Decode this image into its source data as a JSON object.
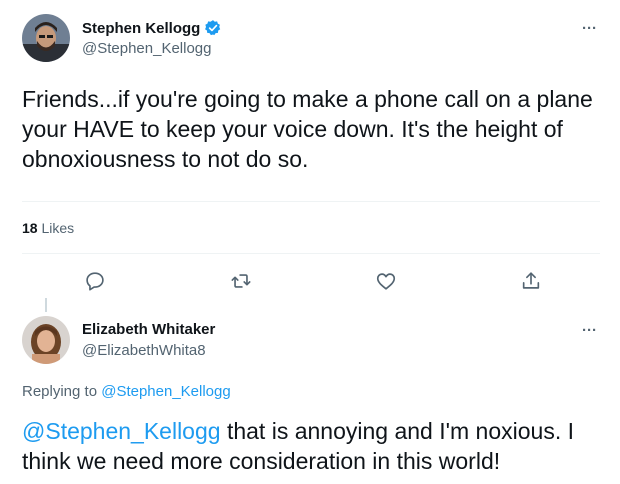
{
  "tweet": {
    "author": {
      "name": "Stephen Kellogg",
      "handle": "@Stephen_Kellogg",
      "verified": true
    },
    "more_label": "···",
    "text": "Friends...if you're going to make a phone call on a plane your HAVE to keep your voice down. It's the height of obnoxiousness to not do so.",
    "likes_count": "18",
    "likes_label": "Likes",
    "actions": [
      "reply-icon",
      "retweet-icon",
      "like-icon",
      "share-icon"
    ]
  },
  "reply": {
    "author": {
      "name": "Elizabeth Whitaker",
      "handle": "@ElizabethWhita8"
    },
    "more_label": "···",
    "replying_prefix": "Replying to",
    "replying_to": "@Stephen_Kellogg",
    "mention": "@Stephen_Kellogg",
    "text": " that is annoying and I'm noxious. I think we need more consideration in this world!"
  },
  "colors": {
    "accent": "#1d9bf0",
    "text": "#0f1419",
    "secondary": "#536471",
    "divider": "#eff3f4"
  }
}
